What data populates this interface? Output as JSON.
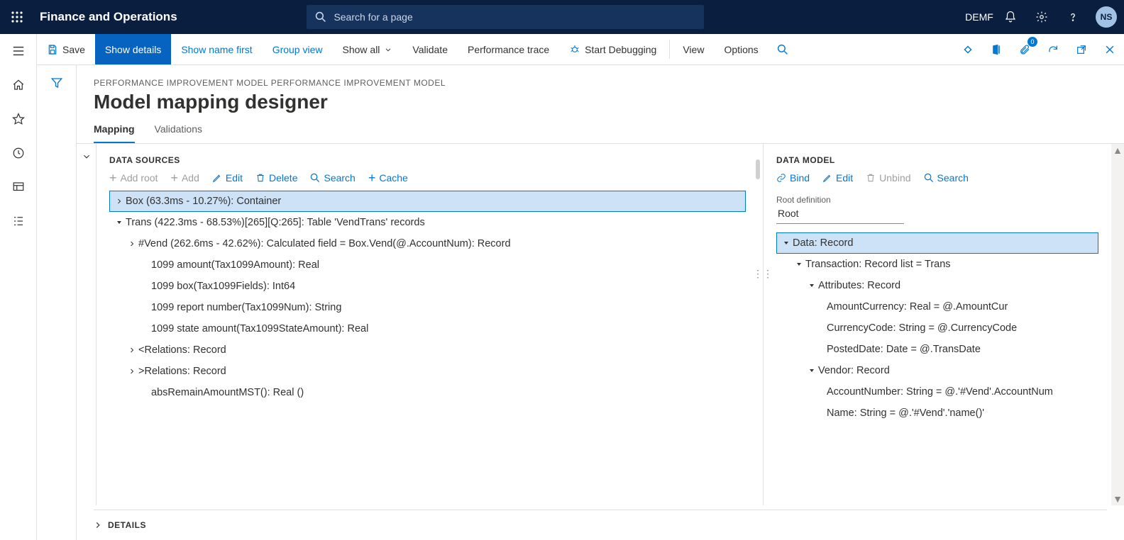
{
  "topbar": {
    "app_title": "Finance and Operations",
    "search_placeholder": "Search for a page",
    "company": "DEMF",
    "avatar_initials": "NS"
  },
  "toolbar": {
    "save": "Save",
    "show_details": "Show details",
    "show_name_first": "Show name first",
    "group_view": "Group view",
    "show_all": "Show all",
    "validate": "Validate",
    "perf_trace": "Performance trace",
    "start_debug": "Start Debugging",
    "view": "View",
    "options": "Options",
    "badge_count": "0"
  },
  "page": {
    "breadcrumb": "PERFORMANCE IMPROVEMENT MODEL PERFORMANCE IMPROVEMENT MODEL",
    "title": "Model mapping designer",
    "tabs": {
      "mapping": "Mapping",
      "validations": "Validations"
    }
  },
  "datasources": {
    "title": "DATA SOURCES",
    "actions": {
      "add_root": "Add root",
      "add": "Add",
      "edit": "Edit",
      "delete": "Delete",
      "search": "Search",
      "cache": "Cache"
    },
    "tree": {
      "n0": "Box (63.3ms - 10.27%): Container",
      "n1": "Trans (422.3ms - 68.53%)[265][Q:265]: Table 'VendTrans' records",
      "n2": "#Vend (262.6ms - 42.62%): Calculated field = Box.Vend(@.AccountNum): Record",
      "n3": "1099 amount(Tax1099Amount): Real",
      "n4": "1099 box(Tax1099Fields): Int64",
      "n5": "1099 report number(Tax1099Num): String",
      "n6": "1099 state amount(Tax1099StateAmount): Real",
      "n7": "<Relations: Record",
      "n8": ">Relations: Record",
      "n9": "absRemainAmountMST(): Real ()"
    }
  },
  "datamodel": {
    "title": "DATA MODEL",
    "actions": {
      "bind": "Bind",
      "edit": "Edit",
      "unbind": "Unbind",
      "search": "Search"
    },
    "root_label": "Root definition",
    "root_value": "Root",
    "tree": {
      "n0": "Data: Record",
      "n1": "Transaction: Record list = Trans",
      "n2": "Attributes: Record",
      "n3": "AmountCurrency: Real = @.AmountCur",
      "n4": "CurrencyCode: String = @.CurrencyCode",
      "n5": "PostedDate: Date = @.TransDate",
      "n6": "Vendor: Record",
      "n7": "AccountNumber: String = @.'#Vend'.AccountNum",
      "n8": "Name: String = @.'#Vend'.'name()'"
    }
  },
  "details": "DETAILS"
}
